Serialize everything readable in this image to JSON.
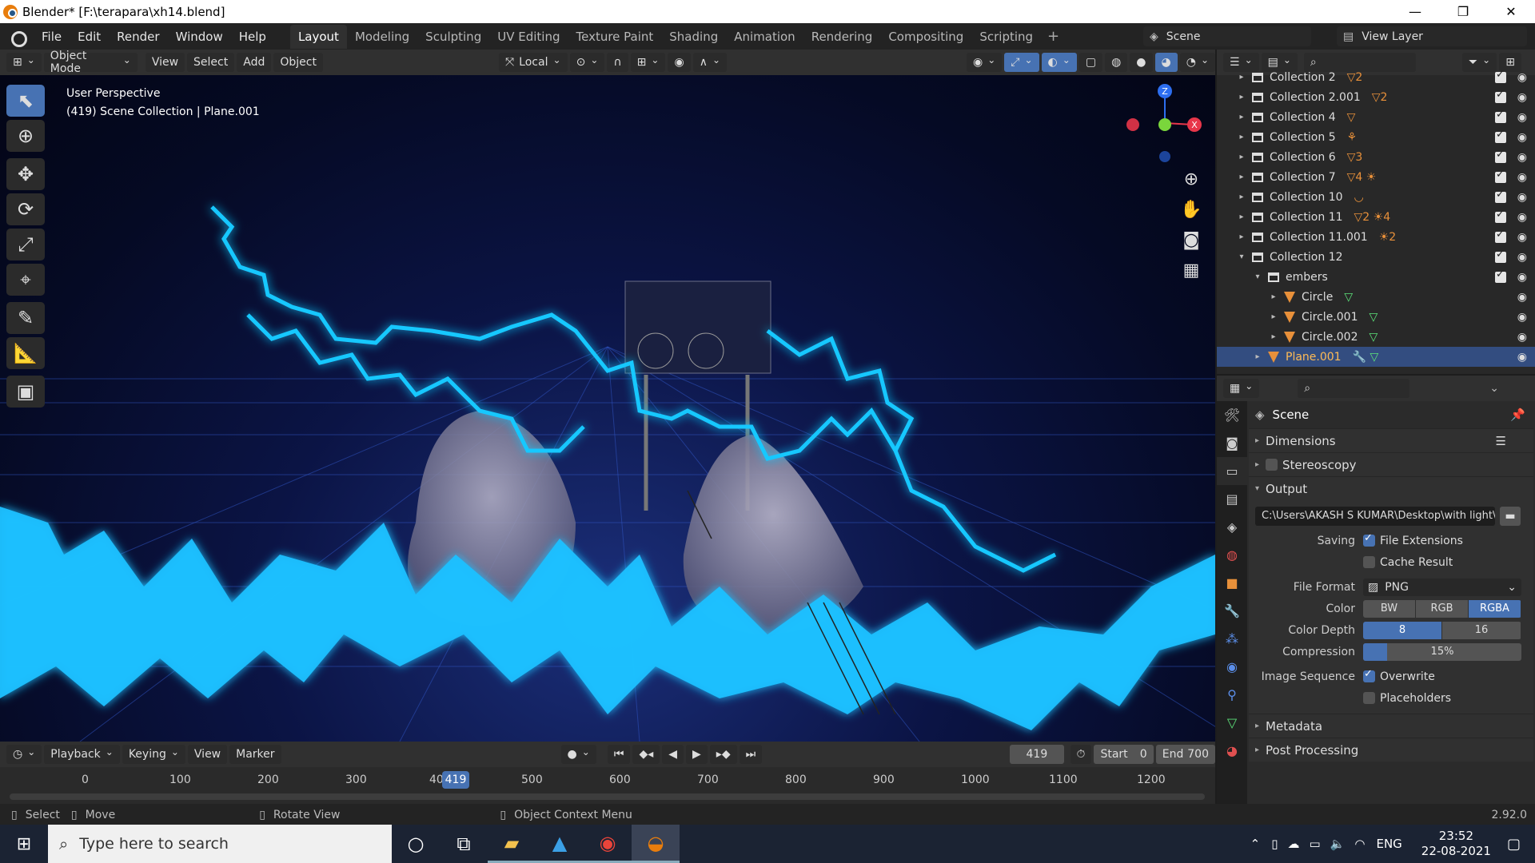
{
  "window": {
    "title": "Blender* [F:\\terapara\\xh14.blend]",
    "minimize": "—",
    "restore": "❐",
    "close": "✕"
  },
  "menu": [
    "File",
    "Edit",
    "Render",
    "Window",
    "Help"
  ],
  "workspaces": [
    "Layout",
    "Modeling",
    "Sculpting",
    "UV Editing",
    "Texture Paint",
    "Shading",
    "Animation",
    "Rendering",
    "Compositing",
    "Scripting"
  ],
  "active_workspace": "Layout",
  "workspace_add": "+",
  "scene_name": "Scene",
  "view_layer": "View Layer",
  "viewport_header": {
    "mode": "Object Mode",
    "view": "View",
    "select": "Select",
    "add": "Add",
    "object": "Object",
    "transform_orientation": "Local"
  },
  "viewport_info": {
    "line1": "User Perspective",
    "line2": "(419) Scene Collection | Plane.001"
  },
  "gizmo": {
    "z": "Z",
    "x": "X",
    "y": "Y"
  },
  "outliner": {
    "rows": [
      {
        "label": "Collection 2",
        "type": "collection",
        "expand": "▸",
        "extra": "▽2",
        "checked": true
      },
      {
        "label": "Collection 2.001",
        "type": "collection",
        "expand": "▸",
        "extra": "▽2",
        "checked": true
      },
      {
        "label": "Collection 4",
        "type": "collection",
        "expand": "▸",
        "extra": "▽",
        "checked": true
      },
      {
        "label": "Collection 5",
        "type": "collection",
        "expand": "▸",
        "extra": "⚘",
        "checked": true
      },
      {
        "label": "Collection 6",
        "type": "collection",
        "expand": "▸",
        "extra": "▽3",
        "checked": true
      },
      {
        "label": "Collection 7",
        "type": "collection",
        "expand": "▸",
        "extra": "▽4 ☀",
        "checked": true
      },
      {
        "label": "Collection 10",
        "type": "collection",
        "expand": "▸",
        "extra": "◡",
        "checked": true
      },
      {
        "label": "Collection 11",
        "type": "collection",
        "expand": "▸",
        "extra": "▽2 ☀4",
        "checked": true
      },
      {
        "label": "Collection 11.001",
        "type": "collection",
        "expand": "▸",
        "extra": "☀2",
        "checked": true
      },
      {
        "label": "Collection 12",
        "type": "collection",
        "expand": "▾",
        "extra": "",
        "checked": true
      },
      {
        "label": "embers",
        "type": "collection",
        "expand": "▾",
        "extra": "",
        "checked": true,
        "indent": 1
      },
      {
        "label": "Circle",
        "type": "object",
        "expand": "▸",
        "extra": "▽",
        "checked": false,
        "indent": 2
      },
      {
        "label": "Circle.001",
        "type": "object",
        "expand": "▸",
        "extra": "▽",
        "checked": false,
        "indent": 2
      },
      {
        "label": "Circle.002",
        "type": "object",
        "expand": "▸",
        "extra": "▽",
        "checked": false,
        "indent": 2
      },
      {
        "label": "Plane.001",
        "type": "object",
        "expand": "▸",
        "extra": "🔧 ▽",
        "checked": false,
        "indent": 1,
        "selected": true
      }
    ]
  },
  "properties": {
    "context": "Scene",
    "panels": {
      "dimensions": "Dimensions",
      "stereoscopy": "Stereoscopy",
      "output": "Output",
      "metadata": "Metadata",
      "post_processing": "Post Processing"
    },
    "output_path": "C:\\Users\\AKASH S KUMAR\\Desktop\\with light\\",
    "saving_label": "Saving",
    "file_extensions": "File Extensions",
    "cache_result": "Cache Result",
    "file_format_label": "File Format",
    "file_format": "PNG",
    "color_label": "Color",
    "color_options": [
      "BW",
      "RGB",
      "RGBA"
    ],
    "color_selected": "RGBA",
    "color_depth_label": "Color Depth",
    "color_depth_options": [
      "8",
      "16"
    ],
    "color_depth_selected": "8",
    "compression_label": "Compression",
    "compression": "15%",
    "compression_value": 0.15,
    "image_sequence_label": "Image Sequence",
    "overwrite": "Overwrite",
    "placeholders": "Placeholders"
  },
  "timeline": {
    "playback": "Playback",
    "keying": "Keying",
    "view": "View",
    "marker": "Marker",
    "current_frame": "419",
    "start_label": "Start",
    "start": "0",
    "end_label": "End",
    "end": "700",
    "ticks": [
      "0",
      "100",
      "200",
      "300",
      "40",
      "500",
      "600",
      "700",
      "800",
      "900",
      "1000",
      "1100",
      "1200"
    ]
  },
  "status": {
    "select": "Select",
    "move": "Move",
    "rotate": "Rotate View",
    "context": "Object Context Menu",
    "version": "2.92.0"
  },
  "taskbar": {
    "search_placeholder": "Type here to search",
    "lang": "ENG",
    "time": "23:52",
    "date": "22-08-2021"
  }
}
